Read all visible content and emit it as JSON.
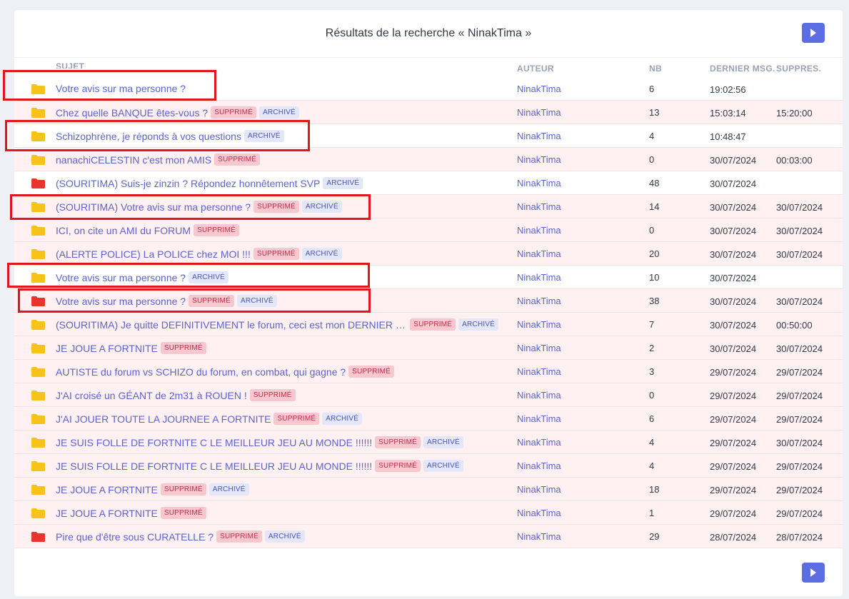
{
  "header": {
    "title": "Résultats de la recherche « NinakTima »"
  },
  "columns": {
    "subject": "SUJET",
    "author": "AUTEUR",
    "nb": "NB",
    "last": "DERNIER MSG.",
    "deleted": "SUPPRES."
  },
  "badges": {
    "supprime": "SUPPRIMÉ",
    "archive": "ARCHIVÉ"
  },
  "colors": {
    "folder_yellow": "#f7c21a",
    "folder_red": "#e8332e",
    "accent": "#5b6de0",
    "highlight": "#e0161d"
  },
  "rows": [
    {
      "title": "Votre avis sur ma personne ?",
      "supprime": false,
      "archive": false,
      "folder": "yellow",
      "author": "NinakTima",
      "nb": "6",
      "last": "19:02:56",
      "deleted": ""
    },
    {
      "title": "Chez quelle BANQUE êtes-vous ?",
      "supprime": true,
      "archive": true,
      "folder": "yellow",
      "author": "NinakTima",
      "nb": "13",
      "last": "15:03:14",
      "deleted": "15:20:00"
    },
    {
      "title": "Schizophrène, je réponds à vos questions",
      "supprime": false,
      "archive": true,
      "folder": "yellow",
      "author": "NinakTima",
      "nb": "4",
      "last": "10:48:47",
      "deleted": ""
    },
    {
      "title": "nanachiCELESTIN c'est mon AMIS",
      "supprime": true,
      "archive": false,
      "folder": "yellow",
      "author": "NinakTima",
      "nb": "0",
      "last": "30/07/2024",
      "deleted": "00:03:00"
    },
    {
      "title": "(SOURITIMA) Suis-je zinzin ? Répondez honnêtement SVP",
      "supprime": false,
      "archive": true,
      "folder": "red",
      "author": "NinakTima",
      "nb": "48",
      "last": "30/07/2024",
      "deleted": ""
    },
    {
      "title": "(SOURITIMA) Votre avis sur ma personne ?",
      "supprime": true,
      "archive": true,
      "folder": "yellow",
      "author": "NinakTima",
      "nb": "14",
      "last": "30/07/2024",
      "deleted": "30/07/2024"
    },
    {
      "title": "ICI, on cite un AMI du FORUM",
      "supprime": true,
      "archive": false,
      "folder": "yellow",
      "author": "NinakTima",
      "nb": "0",
      "last": "30/07/2024",
      "deleted": "30/07/2024"
    },
    {
      "title": "(ALERTE POLICE) La POLICE chez MOI !!!",
      "supprime": true,
      "archive": true,
      "folder": "yellow",
      "author": "NinakTima",
      "nb": "20",
      "last": "30/07/2024",
      "deleted": "30/07/2024"
    },
    {
      "title": "Votre avis sur ma personne ?",
      "supprime": false,
      "archive": true,
      "folder": "yellow",
      "author": "NinakTima",
      "nb": "10",
      "last": "30/07/2024",
      "deleted": ""
    },
    {
      "title": "Votre avis sur ma personne ?",
      "supprime": true,
      "archive": true,
      "folder": "red",
      "author": "NinakTima",
      "nb": "38",
      "last": "30/07/2024",
      "deleted": "30/07/2024"
    },
    {
      "title": "(SOURITIMA) Je quitte DEFINITIVEMENT le forum, ceci est mon DERNIER to...",
      "supprime": true,
      "archive": true,
      "folder": "yellow",
      "author": "NinakTima",
      "nb": "7",
      "last": "30/07/2024",
      "deleted": "00:50:00"
    },
    {
      "title": "JE JOUE A FORTNITE",
      "supprime": true,
      "archive": false,
      "folder": "yellow",
      "author": "NinakTima",
      "nb": "2",
      "last": "30/07/2024",
      "deleted": "30/07/2024"
    },
    {
      "title": "AUTISTE du forum vs SCHIZO du forum, en combat, qui gagne ?",
      "supprime": true,
      "archive": false,
      "folder": "yellow",
      "author": "NinakTima",
      "nb": "3",
      "last": "29/07/2024",
      "deleted": "29/07/2024"
    },
    {
      "title": "J'AI croisé un GÉANT de 2m31 à ROUEN !",
      "supprime": true,
      "archive": false,
      "folder": "yellow",
      "author": "NinakTima",
      "nb": "0",
      "last": "29/07/2024",
      "deleted": "29/07/2024"
    },
    {
      "title": "J'AI JOUER TOUTE LA JOURNEE A FORTNITE",
      "supprime": true,
      "archive": true,
      "folder": "yellow",
      "author": "NinakTima",
      "nb": "6",
      "last": "29/07/2024",
      "deleted": "29/07/2024"
    },
    {
      "title": "JE SUIS FOLLE DE FORTNITE C LE MEILLEUR JEU AU MONDE !!!!!!",
      "supprime": true,
      "archive": true,
      "folder": "yellow",
      "author": "NinakTima",
      "nb": "4",
      "last": "29/07/2024",
      "deleted": "30/07/2024"
    },
    {
      "title": "JE SUIS FOLLE DE FORTNITE C LE MEILLEUR JEU AU MONDE !!!!!!",
      "supprime": true,
      "archive": true,
      "folder": "yellow",
      "author": "NinakTima",
      "nb": "4",
      "last": "29/07/2024",
      "deleted": "29/07/2024"
    },
    {
      "title": "JE JOUE A FORTNITE",
      "supprime": true,
      "archive": true,
      "folder": "yellow",
      "author": "NinakTima",
      "nb": "18",
      "last": "29/07/2024",
      "deleted": "29/07/2024"
    },
    {
      "title": "JE JOUE A FORTNITE",
      "supprime": true,
      "archive": false,
      "folder": "yellow",
      "author": "NinakTima",
      "nb": "1",
      "last": "29/07/2024",
      "deleted": "29/07/2024"
    },
    {
      "title": "Pire que d'être sous CURATELLE ?",
      "supprime": true,
      "archive": true,
      "folder": "red",
      "author": "NinakTima",
      "nb": "29",
      "last": "28/07/2024",
      "deleted": "28/07/2024"
    }
  ]
}
